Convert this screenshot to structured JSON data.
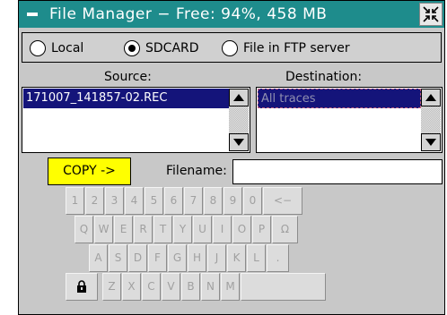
{
  "window": {
    "title": "File Manager − Free: 94%, 458 MB",
    "close_icon": "collapse-arrows-icon"
  },
  "source_options": [
    {
      "label": "Local",
      "selected": false
    },
    {
      "label": "SDCARD",
      "selected": true
    },
    {
      "label": "File in FTP server",
      "selected": false
    }
  ],
  "source": {
    "label": "Source:",
    "items": [
      "171007_141857-02.REC"
    ]
  },
  "destination": {
    "label": "Destination:",
    "items": [
      "All traces"
    ]
  },
  "copy_label": "COPY ->",
  "filename": {
    "label": "Filename:",
    "value": ""
  },
  "keyboard": {
    "row1": [
      "1",
      "2",
      "3",
      "4",
      "5",
      "6",
      "7",
      "8",
      "9",
      "0",
      "<−"
    ],
    "row2": [
      "Q",
      "W",
      "E",
      "R",
      "T",
      "Y",
      "U",
      "I",
      "O",
      "P",
      "Ω"
    ],
    "row3": [
      "A",
      "S",
      "D",
      "F",
      "G",
      "H",
      "J",
      "K",
      "L",
      "."
    ],
    "row4": [
      "Z",
      "X",
      "C",
      "V",
      "B",
      "N",
      "M",
      ""
    ],
    "lock_icon": "padlock-icon"
  },
  "colors": {
    "titlebar": "#1e8c8c",
    "selection": "#14147a",
    "copy_button": "#ffff00"
  }
}
